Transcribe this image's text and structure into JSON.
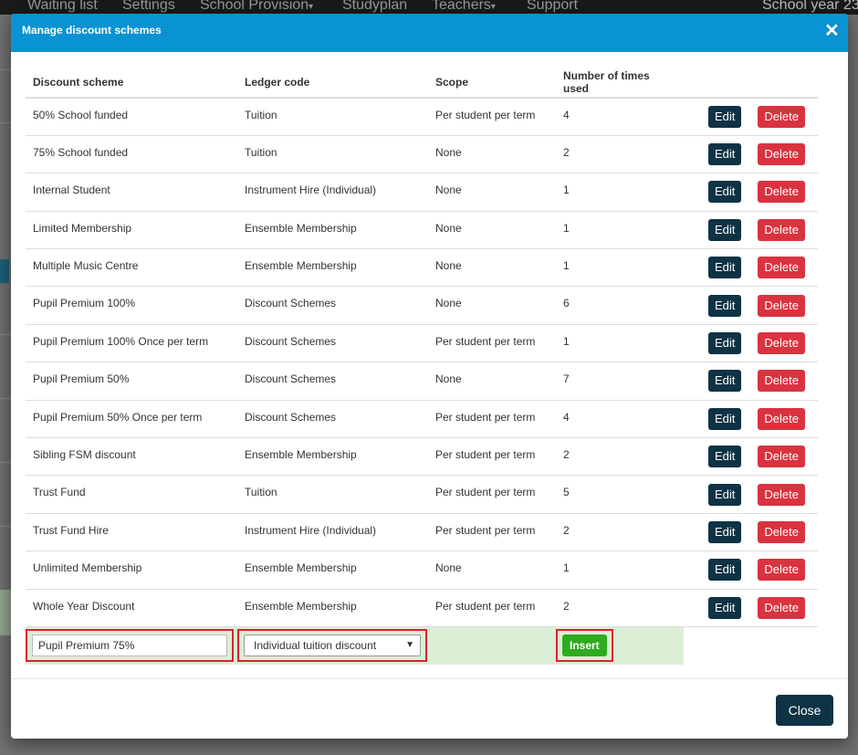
{
  "background": {
    "nav_items": [
      "Waiting list",
      "Settings",
      "School Provision",
      "Studyplan",
      "Teachers",
      "Support"
    ],
    "nav_dropdown_caret": "▾",
    "school_year": "School year 23/"
  },
  "modal": {
    "title": "Manage discount schemes",
    "close_icon": "✕",
    "columns": [
      "Discount scheme",
      "Ledger code",
      "Scope",
      "Number of times used"
    ],
    "rows": [
      {
        "scheme": "50% School funded",
        "ledger": "Tuition",
        "scope": "Per student per term",
        "times": "4"
      },
      {
        "scheme": "75% School funded",
        "ledger": "Tuition",
        "scope": "None",
        "times": "2"
      },
      {
        "scheme": "Internal Student",
        "ledger": "Instrument Hire (Individual)",
        "scope": "None",
        "times": "1"
      },
      {
        "scheme": "Limited Membership",
        "ledger": "Ensemble Membership",
        "scope": "None",
        "times": "1"
      },
      {
        "scheme": "Multiple Music Centre",
        "ledger": "Ensemble Membership",
        "scope": "None",
        "times": "1"
      },
      {
        "scheme": "Pupil Premium 100%",
        "ledger": "Discount Schemes",
        "scope": "None",
        "times": "6"
      },
      {
        "scheme": "Pupil Premium 100% Once per term",
        "ledger": "Discount Schemes",
        "scope": "Per student per term",
        "times": "1"
      },
      {
        "scheme": "Pupil Premium 50%",
        "ledger": "Discount Schemes",
        "scope": "None",
        "times": "7"
      },
      {
        "scheme": "Pupil Premium 50% Once per term",
        "ledger": "Discount Schemes",
        "scope": "Per student per term",
        "times": "4"
      },
      {
        "scheme": "Sibling FSM discount",
        "ledger": "Ensemble Membership",
        "scope": "Per student per term",
        "times": "2"
      },
      {
        "scheme": "Trust Fund",
        "ledger": "Tuition",
        "scope": "Per student per term",
        "times": "5"
      },
      {
        "scheme": "Trust Fund Hire",
        "ledger": "Instrument Hire (Individual)",
        "scope": "Per student per term",
        "times": "2"
      },
      {
        "scheme": "Unlimited Membership",
        "ledger": "Ensemble Membership",
        "scope": "None",
        "times": "1"
      },
      {
        "scheme": "Whole Year Discount",
        "ledger": "Ensemble Membership",
        "scope": "Per student per term",
        "times": "2"
      }
    ],
    "edit_label": "Edit",
    "delete_label": "Delete",
    "new_row": {
      "scheme_value": "Pupil Premium 75%",
      "ledger_selected": "Individual tuition discount",
      "insert_label": "Insert"
    },
    "close_label": "Close"
  },
  "colors": {
    "header_blue": "#0a93d2",
    "edit_navy": "#0e3345",
    "delete_red": "#d9333f",
    "insert_green": "#2eab1f",
    "highlight_red": "#d9232d",
    "new_row_green": "#dbefd6"
  }
}
